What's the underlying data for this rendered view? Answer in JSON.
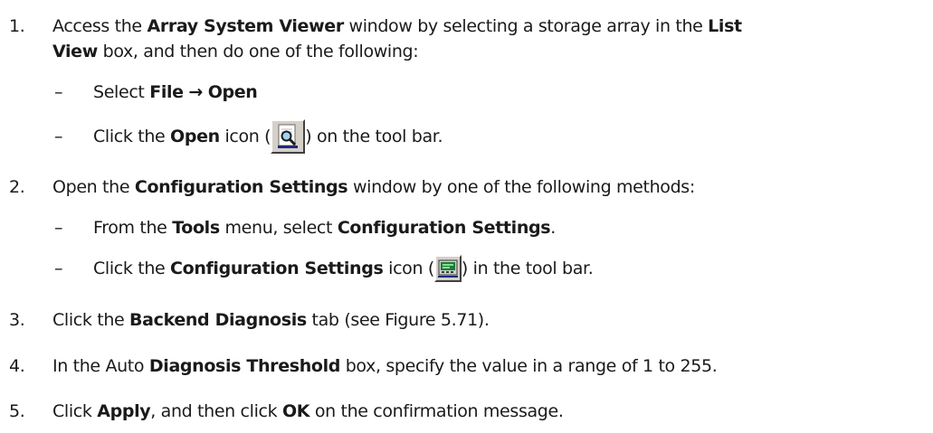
{
  "steps": [
    {
      "number": "1.",
      "line1": {
        "t1": "Access the ",
        "b1": "Array System Viewer",
        "t2": " window by selecting a storage array in the ",
        "b2": "List"
      },
      "line2": {
        "b1": "View",
        "t1": " box, and then do one of the following:"
      },
      "subs": [
        {
          "t1": "Select ",
          "b1": "File",
          "arrow": "→",
          "b2": "Open"
        },
        {
          "t1": "Click the ",
          "b1": "Open",
          "t2": " icon (",
          "icon": "open-magnifier-icon",
          "t3": ") on the tool bar."
        }
      ]
    },
    {
      "number": "2.",
      "line1": {
        "t1": "Open the ",
        "b1": "Configuration Settings",
        "t2": " window by one of the following methods:"
      },
      "subs": [
        {
          "t1": "From the ",
          "b1": "Tools",
          "t2": " menu, select ",
          "b2": "Configuration Settings",
          "t3": "."
        },
        {
          "t1": "Click the ",
          "b1": "Configuration Settings",
          "t2": " icon (",
          "icon": "configuration-settings-icon",
          "t3": ") in the tool bar."
        }
      ]
    },
    {
      "number": "3.",
      "line1": {
        "t1": "Click the ",
        "b1": "Backend Diagnosis",
        "t2": " tab (see Figure 5.71)."
      }
    },
    {
      "number": "4.",
      "line1": {
        "t1": "In the Auto ",
        "b1": "Diagnosis Threshold",
        "t2": " box, specify the value in a range of 1 to 255."
      }
    },
    {
      "number": "5.",
      "line1": {
        "t1": "Click ",
        "b1": "Apply",
        "t2": ", and then click ",
        "b2": "OK",
        "t3": " on the confirmation message."
      }
    }
  ],
  "dash_symbol": "–"
}
